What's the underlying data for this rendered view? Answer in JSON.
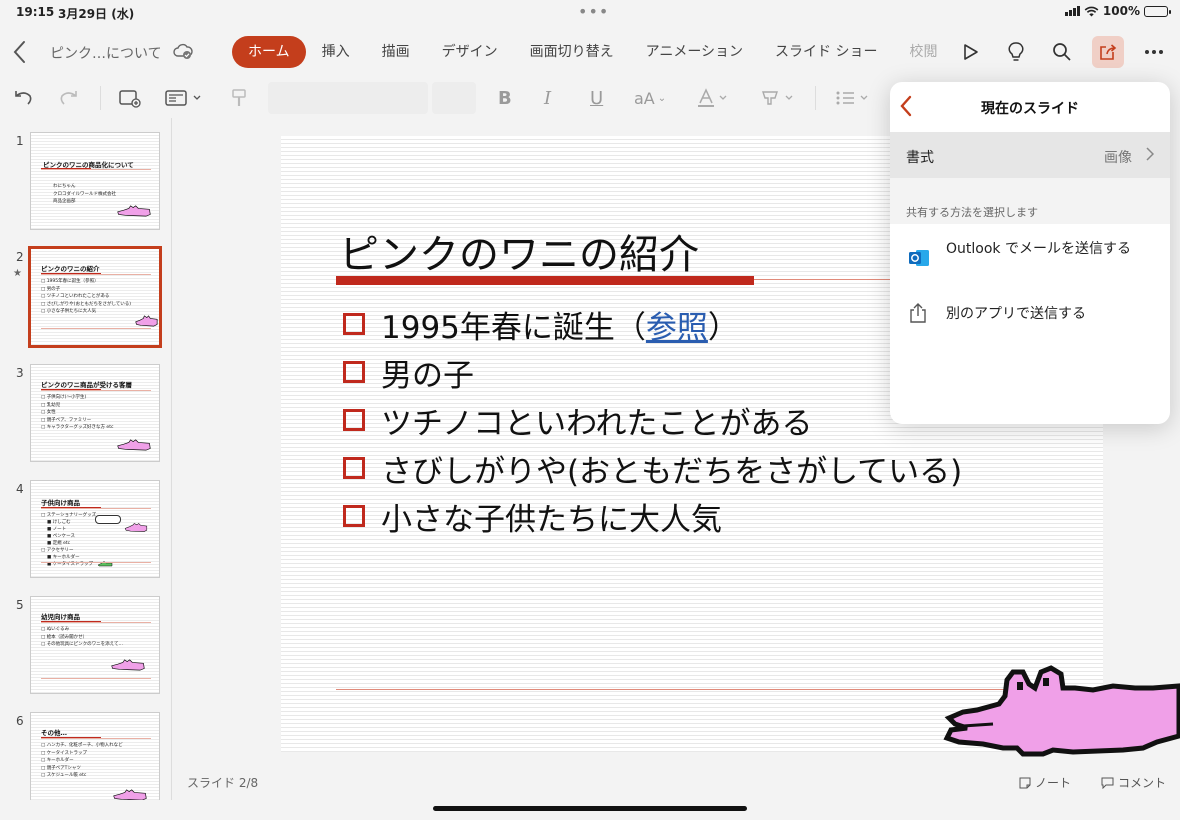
{
  "status": {
    "time": "19:15",
    "date": "3月29日 (水)",
    "battery": "100%"
  },
  "toolbar": {
    "doc_title": "ピンク…について",
    "tabs": [
      {
        "label": "ホーム"
      },
      {
        "label": "挿入"
      },
      {
        "label": "描画"
      },
      {
        "label": "デザイン"
      },
      {
        "label": "画面切り替え"
      },
      {
        "label": "アニメーション"
      },
      {
        "label": "スライド ショー"
      },
      {
        "label": "校閲"
      }
    ]
  },
  "thumbnails": [
    {
      "num": "1",
      "title": "ピンクのワニの商品化について",
      "items": [
        "わにちゃん",
        "クロコダイルワールド株式会社",
        "商品企画部"
      ]
    },
    {
      "num": "2",
      "title": "ピンクのワニの紹介",
      "items": [
        "1995年春に誕生（参照）",
        "男の子",
        "ツチノコといわれたことがある",
        "さびしがりや(おともだちをさがしている)",
        "小さな子供たちに大人気"
      ]
    },
    {
      "num": "3",
      "title": "ピンクのワニ商品が受ける客層",
      "items": [
        "子供向け(～小学生)",
        "乳幼児",
        "女性",
        "親子ペア、ファミリー",
        "キャラクターグッズ好きな方 etc"
      ]
    },
    {
      "num": "4",
      "title": "子供向け商品",
      "items": [
        "ステーショナリーグッズ",
        "けしごむ",
        "ノート",
        "ペンケース",
        "定規 etc",
        "アクセサリー",
        "キーホルダー",
        "ケータイストラップ"
      ]
    },
    {
      "num": "5",
      "title": "幼児向け商品",
      "items": [
        "ぬいぐるみ",
        "絵本（読み聞かせ）",
        "その他玩具にピンクのワニを添えて…"
      ]
    },
    {
      "num": "6",
      "title": "その他…",
      "items": [
        "ハンカチ、化粧ポーチ、小物入れなど",
        "ケータイストラップ",
        "キーホルダー",
        "親子ペアTシャツ",
        "スケジュール帳 etc"
      ]
    }
  ],
  "slide": {
    "title": "ピンクのワニの紹介",
    "bullets": [
      {
        "pre": "1995年春に誕生（",
        "link": "参照",
        "post": "）"
      },
      {
        "pre": "男の子",
        "link": "",
        "post": ""
      },
      {
        "pre": "ツチノコといわれたことがある",
        "link": "",
        "post": ""
      },
      {
        "pre": "さびしがりや(おともだちをさがしている)",
        "link": "",
        "post": ""
      },
      {
        "pre": "小さな子供たちに大人気",
        "link": "",
        "post": ""
      }
    ],
    "counter": "スライド 2/8",
    "notes_label": "ノート",
    "comments_label": "コメント"
  },
  "popover": {
    "title": "現在のスライド",
    "format_label": "書式",
    "format_value": "画像",
    "section_label": "共有する方法を選択します",
    "outlook_label": "Outlook でメールを送信する",
    "other_app_label": "別のアプリで送信する"
  },
  "colors": {
    "accent": "#c43e1c",
    "title_bar": "#c0291d",
    "croc_pink": "#f0a0e8",
    "link": "#2a5db0"
  }
}
